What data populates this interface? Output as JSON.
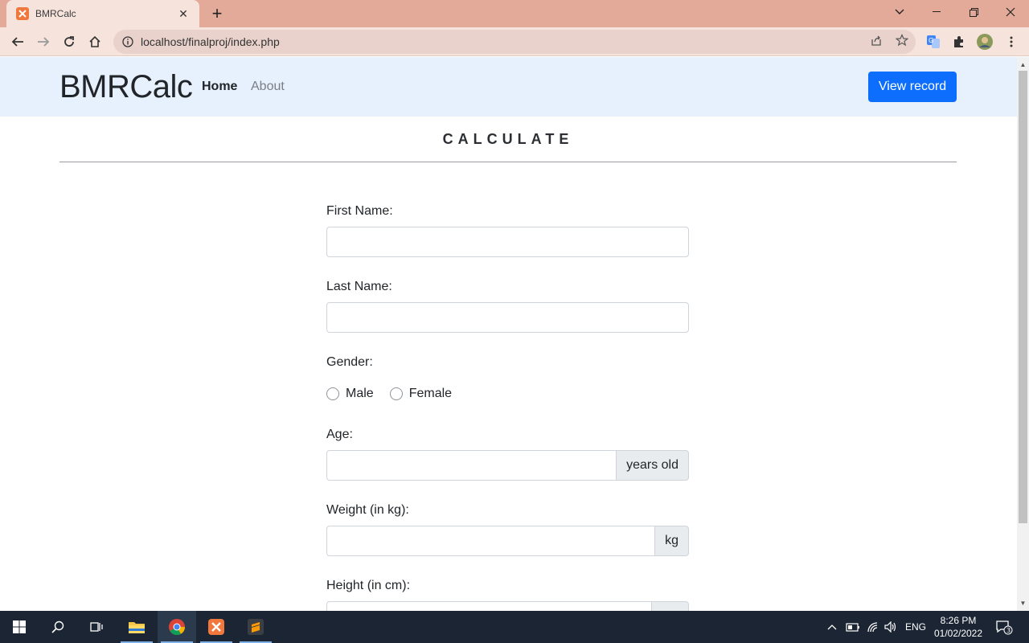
{
  "browser": {
    "tab_title": "BMRCalc",
    "url": "localhost/finalproj/index.php"
  },
  "navbar": {
    "brand": "BMRCalc",
    "links": [
      {
        "label": "Home",
        "active": true
      },
      {
        "label": "About",
        "active": false
      }
    ],
    "record_button": "View record"
  },
  "main": {
    "heading": "CALCULATE",
    "fields": {
      "first_name": {
        "label": "First Name:",
        "value": ""
      },
      "last_name": {
        "label": "Last Name:",
        "value": ""
      },
      "gender": {
        "label": "Gender:",
        "options": [
          "Male",
          "Female"
        ]
      },
      "age": {
        "label": "Age:",
        "addon": "years old",
        "value": ""
      },
      "weight": {
        "label": "Weight (in kg):",
        "addon": "kg",
        "value": ""
      },
      "height": {
        "label": "Height (in cm):",
        "value": ""
      }
    }
  },
  "taskbar": {
    "time": "8:26 PM",
    "date": "01/02/2022",
    "language": "ENG",
    "notification_count": "3"
  },
  "colors": {
    "tabstrip": "#e3aa9a",
    "toolbar": "#f6e3dc",
    "navbar_bg": "#e7f1fd",
    "primary_button": "#0d6efd",
    "taskbar": "#1b2533"
  }
}
